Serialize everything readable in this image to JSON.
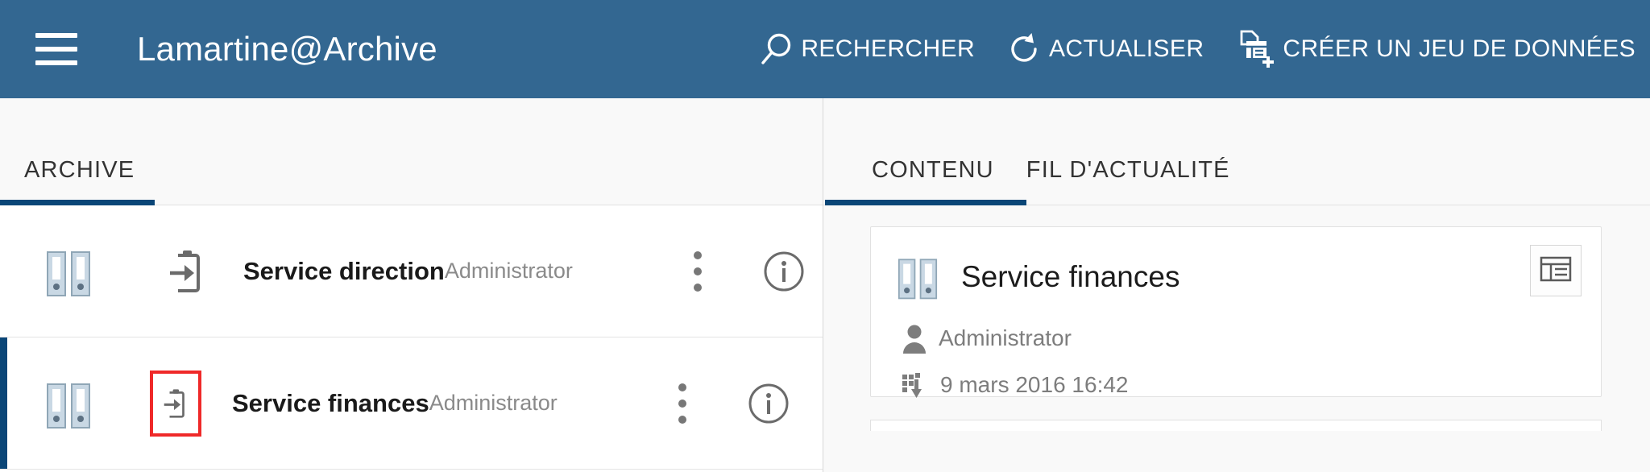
{
  "header": {
    "menu_icon": "hamburger-icon",
    "title": "Lamartine@Archive",
    "actions": [
      {
        "icon": "search-icon",
        "label": "RECHERCHER"
      },
      {
        "icon": "refresh-icon",
        "label": "ACTUALISER"
      },
      {
        "icon": "create-dataset-icon",
        "label": "CRÉER UN JEU DE DONNÉES"
      }
    ],
    "background_color": "#336791"
  },
  "left_panel": {
    "tabs": [
      {
        "label": "ARCHIVE",
        "active": true
      }
    ],
    "accent_color": "#0a4677",
    "rows": [
      {
        "binder_icon": "binders-icon",
        "type_icon": "import-clipboard-icon",
        "title": "Service direction",
        "owner": "Administrator",
        "kebab_icon": "more-vertical-icon",
        "info_icon": "info-circle-icon",
        "selected": false,
        "highlighted_icon": false
      },
      {
        "binder_icon": "binders-icon",
        "type_icon": "import-clipboard-icon",
        "title": "Service finances",
        "owner": "Administrator",
        "kebab_icon": "more-vertical-icon",
        "info_icon": "info-circle-icon",
        "selected": true,
        "highlighted_icon": true
      }
    ],
    "highlight_color": "#ef2929"
  },
  "right_panel": {
    "tabs": [
      {
        "label": "CONTENU",
        "active": true
      },
      {
        "label": "FIL D'ACTUALITÉ",
        "active": false
      }
    ],
    "detail_card": {
      "binder_icon": "binders-icon",
      "title": "Service finances",
      "owner_icon": "user-icon",
      "owner": "Administrator",
      "date_icon": "dataset-icon",
      "date": "9 mars 2016 16:42",
      "action_icon": "table-view-icon"
    }
  }
}
